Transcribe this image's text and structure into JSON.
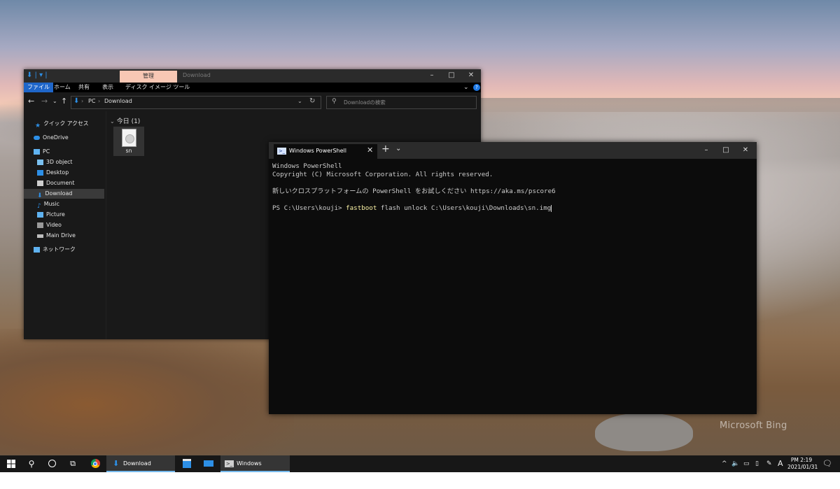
{
  "desktop": {
    "watermark": "Microsoft Bing"
  },
  "explorer": {
    "quick_access_toolbar": "⬇ | ▾ |",
    "manage_tab": "管理",
    "window_title": "Download",
    "controls": {
      "minimize": "–",
      "maximize": "□",
      "close": "✕"
    },
    "ribbon_tabs": [
      "ファイル",
      "ホーム",
      "共有",
      "表示",
      "ディスク イメージ ツール"
    ],
    "address": {
      "crumbs": [
        "PC",
        "Download"
      ],
      "separator": "›"
    },
    "search_placeholder": "Downloadの検索",
    "sidebar": [
      {
        "label": "クイック アクセス",
        "icon": "star-icon",
        "color": "#2d8fe6"
      },
      {
        "label": "OneDrive",
        "icon": "cloud-icon",
        "color": "#2d8fe6"
      },
      {
        "label": "PC",
        "icon": "computer-icon",
        "color": "#5fb2f0"
      },
      {
        "label": "3D object",
        "icon": "cube-icon",
        "color": "#7ac0f0"
      },
      {
        "label": "Desktop",
        "icon": "desktop-icon",
        "color": "#2d8fe6"
      },
      {
        "label": "Document",
        "icon": "document-icon",
        "color": "#cfcfcf"
      },
      {
        "label": "Download",
        "icon": "download-icon",
        "color": "#2d8fe6"
      },
      {
        "label": "Music",
        "icon": "music-icon",
        "color": "#2d8fe6"
      },
      {
        "label": "Picture",
        "icon": "picture-icon",
        "color": "#5fb2f0"
      },
      {
        "label": "Video",
        "icon": "video-icon",
        "color": "#9a9a9a"
      },
      {
        "label": "Main Drive",
        "icon": "drive-icon",
        "color": "#bdbdbd"
      },
      {
        "label": "ネットワーク",
        "icon": "network-icon",
        "color": "#5fb2f0"
      }
    ],
    "selected_sidebar_item": "Download",
    "group_header": "今日 (1)",
    "files": [
      {
        "name": "sn",
        "icon": "disc-image-file-icon"
      }
    ]
  },
  "powershell": {
    "tab_title": "Windows PowerShell",
    "new_tab": "+",
    "dropdown": "⌄",
    "controls": {
      "minimize": "–",
      "maximize": "□",
      "close": "✕"
    },
    "lines": [
      "Windows PowerShell",
      "Copyright (C) Microsoft Corporation. All rights reserved.",
      "",
      "新しいクロスプラットフォームの PowerShell をお試しください https://aka.ms/pscore6",
      ""
    ],
    "prompt": "PS C:\\Users\\kouji> ",
    "command": "fastboot",
    "command_args": " flash unlock C:\\Users\\kouji\\Downloads\\sn.img"
  },
  "taskbar": {
    "apps": [
      {
        "label": "Download",
        "icon": "file-explorer-icon"
      },
      {
        "label": "Windows PowerShell",
        "icon": "powershell-icon"
      }
    ],
    "tray": {
      "ime": "A"
    },
    "clock": {
      "time": "PM 2:19",
      "date": "2021/01/31"
    }
  },
  "colors": {
    "accent": "#1f66c9",
    "manage_tab": "#f7c7b4",
    "ps_command": "#f9f1a5",
    "taskbar_underline": "#76b9ed"
  }
}
